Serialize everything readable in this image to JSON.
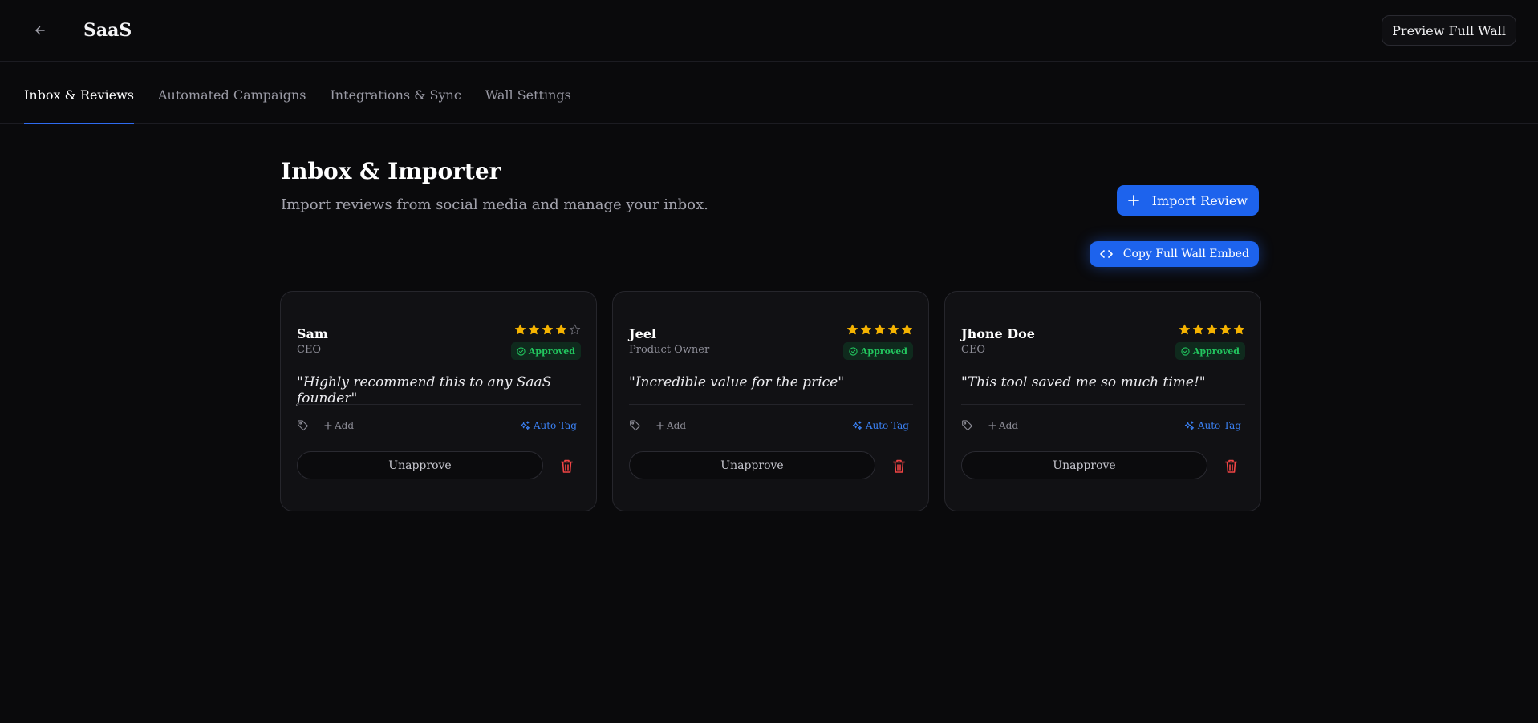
{
  "header": {
    "title": "SaaS",
    "preview_label": "Preview Full Wall"
  },
  "tabs": [
    {
      "label": "Inbox & Reviews",
      "active": true
    },
    {
      "label": "Automated Campaigns",
      "active": false
    },
    {
      "label": "Integrations & Sync",
      "active": false
    },
    {
      "label": "Wall Settings",
      "active": false
    }
  ],
  "page": {
    "title": "Inbox & Importer",
    "subtitle": "Import reviews from social media and manage your inbox.",
    "import_label": "Import Review",
    "embed_label": "Copy Full Wall Embed"
  },
  "colors": {
    "accent": "#1d63ed",
    "star": "#f5b301",
    "approved": "#22c55e",
    "danger": "#ef4444"
  },
  "cards": [
    {
      "name": "Sam",
      "role": "CEO",
      "rating": 4,
      "status": "Approved",
      "quote": "\"Highly recommend this to any SaaS founder\"",
      "add_tag_label": "Add",
      "auto_tag_label": "Auto Tag",
      "action_label": "Unapprove"
    },
    {
      "name": "Jeel",
      "role": "Product Owner",
      "rating": 5,
      "status": "Approved",
      "quote": "\"Incredible value for the price\"",
      "add_tag_label": "Add",
      "auto_tag_label": "Auto Tag",
      "action_label": "Unapprove"
    },
    {
      "name": "Jhone Doe",
      "role": "CEO",
      "rating": 5,
      "status": "Approved",
      "quote": "\"This tool saved me so much time!\"",
      "add_tag_label": "Add",
      "auto_tag_label": "Auto Tag",
      "action_label": "Unapprove"
    }
  ]
}
